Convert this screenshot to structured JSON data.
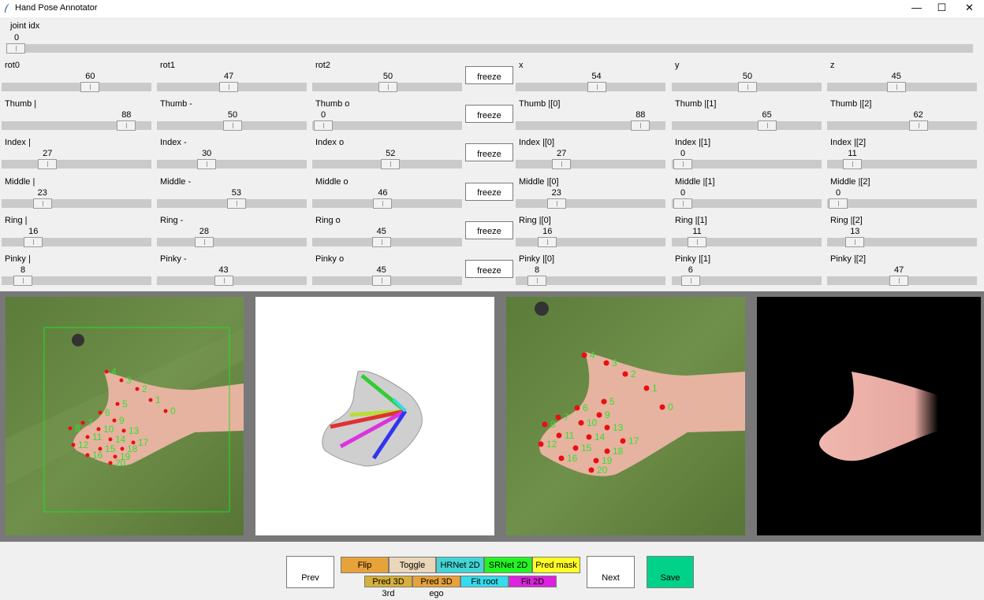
{
  "window": {
    "title": "Hand Pose Annotator",
    "minimize_glyph": "—",
    "maximize_glyph": "☐",
    "close_glyph": "✕"
  },
  "joint": {
    "label": "joint idx",
    "value": "0",
    "level": 0
  },
  "sliders": [
    [
      {
        "label": "rot0",
        "value": "60",
        "level": 0.6
      },
      {
        "label": "rot1",
        "value": "47",
        "level": 0.47
      },
      {
        "label": "rot2",
        "value": "50",
        "level": 0.5
      },
      {
        "label": "x",
        "value": "54",
        "level": 0.54
      },
      {
        "label": "y",
        "value": "50",
        "level": 0.5
      },
      {
        "label": "z",
        "value": "45",
        "level": 0.45
      }
    ],
    [
      {
        "label": "Thumb |",
        "value": "88",
        "level": 0.88
      },
      {
        "label": "Thumb -",
        "value": "50",
        "level": 0.5
      },
      {
        "label": "Thumb o",
        "value": "0",
        "level": 0
      },
      {
        "label": "Thumb |[0]",
        "value": "88",
        "level": 0.88
      },
      {
        "label": "Thumb |[1]",
        "value": "65",
        "level": 0.65
      },
      {
        "label": "Thumb |[2]",
        "value": "62",
        "level": 0.62
      }
    ],
    [
      {
        "label": "Index |",
        "value": "27",
        "level": 0.27
      },
      {
        "label": "Index -",
        "value": "30",
        "level": 0.3
      },
      {
        "label": "Index o",
        "value": "52",
        "level": 0.52
      },
      {
        "label": "Index |[0]",
        "value": "27",
        "level": 0.27
      },
      {
        "label": "Index |[1]",
        "value": "0",
        "level": 0
      },
      {
        "label": "Index |[2]",
        "value": "11",
        "level": 0.11
      }
    ],
    [
      {
        "label": "Middle |",
        "value": "23",
        "level": 0.23
      },
      {
        "label": "Middle -",
        "value": "53",
        "level": 0.53
      },
      {
        "label": "Middle o",
        "value": "46",
        "level": 0.46
      },
      {
        "label": "Middle |[0]",
        "value": "23",
        "level": 0.23
      },
      {
        "label": "Middle |[1]",
        "value": "0",
        "level": 0
      },
      {
        "label": "Middle |[2]",
        "value": "0",
        "level": 0
      }
    ],
    [
      {
        "label": "Ring |",
        "value": "16",
        "level": 0.16
      },
      {
        "label": "Ring -",
        "value": "28",
        "level": 0.28
      },
      {
        "label": "Ring o",
        "value": "45",
        "level": 0.45
      },
      {
        "label": "Ring |[0]",
        "value": "16",
        "level": 0.16
      },
      {
        "label": "Ring |[1]",
        "value": "11",
        "level": 0.11
      },
      {
        "label": "Ring |[2]",
        "value": "13",
        "level": 0.13
      }
    ],
    [
      {
        "label": "Pinky |",
        "value": "8",
        "level": 0.08
      },
      {
        "label": "Pinky -",
        "value": "43",
        "level": 0.43
      },
      {
        "label": "Pinky o",
        "value": "45",
        "level": 0.45
      },
      {
        "label": "Pinky |[0]",
        "value": "8",
        "level": 0.08
      },
      {
        "label": "Pinky |[1]",
        "value": "6",
        "level": 0.06
      },
      {
        "label": "Pinky |[2]",
        "value": "47",
        "level": 0.47
      }
    ]
  ],
  "freeze_label": "freeze",
  "keypoint_labels": [
    "0",
    "1",
    "2",
    "3",
    "4",
    "5",
    "6",
    "7",
    "8",
    "9",
    "10",
    "11",
    "12",
    "13",
    "14",
    "15",
    "16",
    "17",
    "18",
    "19",
    "20"
  ],
  "colors": {
    "keypoint": "#e81010",
    "keypoint_label": "#31e031",
    "bbox": "#22dd22",
    "background_green": "#6a8a45"
  },
  "buttons": {
    "prev": "Prev",
    "next": "Next",
    "save": "Save",
    "save_color": "#00d28a",
    "row1": [
      {
        "label": "Flip",
        "color": "#e8a23a"
      },
      {
        "label": "Toggle",
        "color": "#ead6b8"
      },
      {
        "label": "HRNet 2D",
        "color": "#44d5d5"
      },
      {
        "label": "SRNet 2D",
        "color": "#22f522"
      },
      {
        "label": "Pred mask",
        "color": "#ffff22"
      }
    ],
    "row2": [
      {
        "label": "Pred 3D 3rd",
        "color": "#d6b03a"
      },
      {
        "label": "Pred 3D ego",
        "color": "#e8a23a"
      },
      {
        "label": "Fit root",
        "color": "#33ddee"
      },
      {
        "label": "Fit 2D",
        "color": "#dd22dd"
      }
    ]
  }
}
